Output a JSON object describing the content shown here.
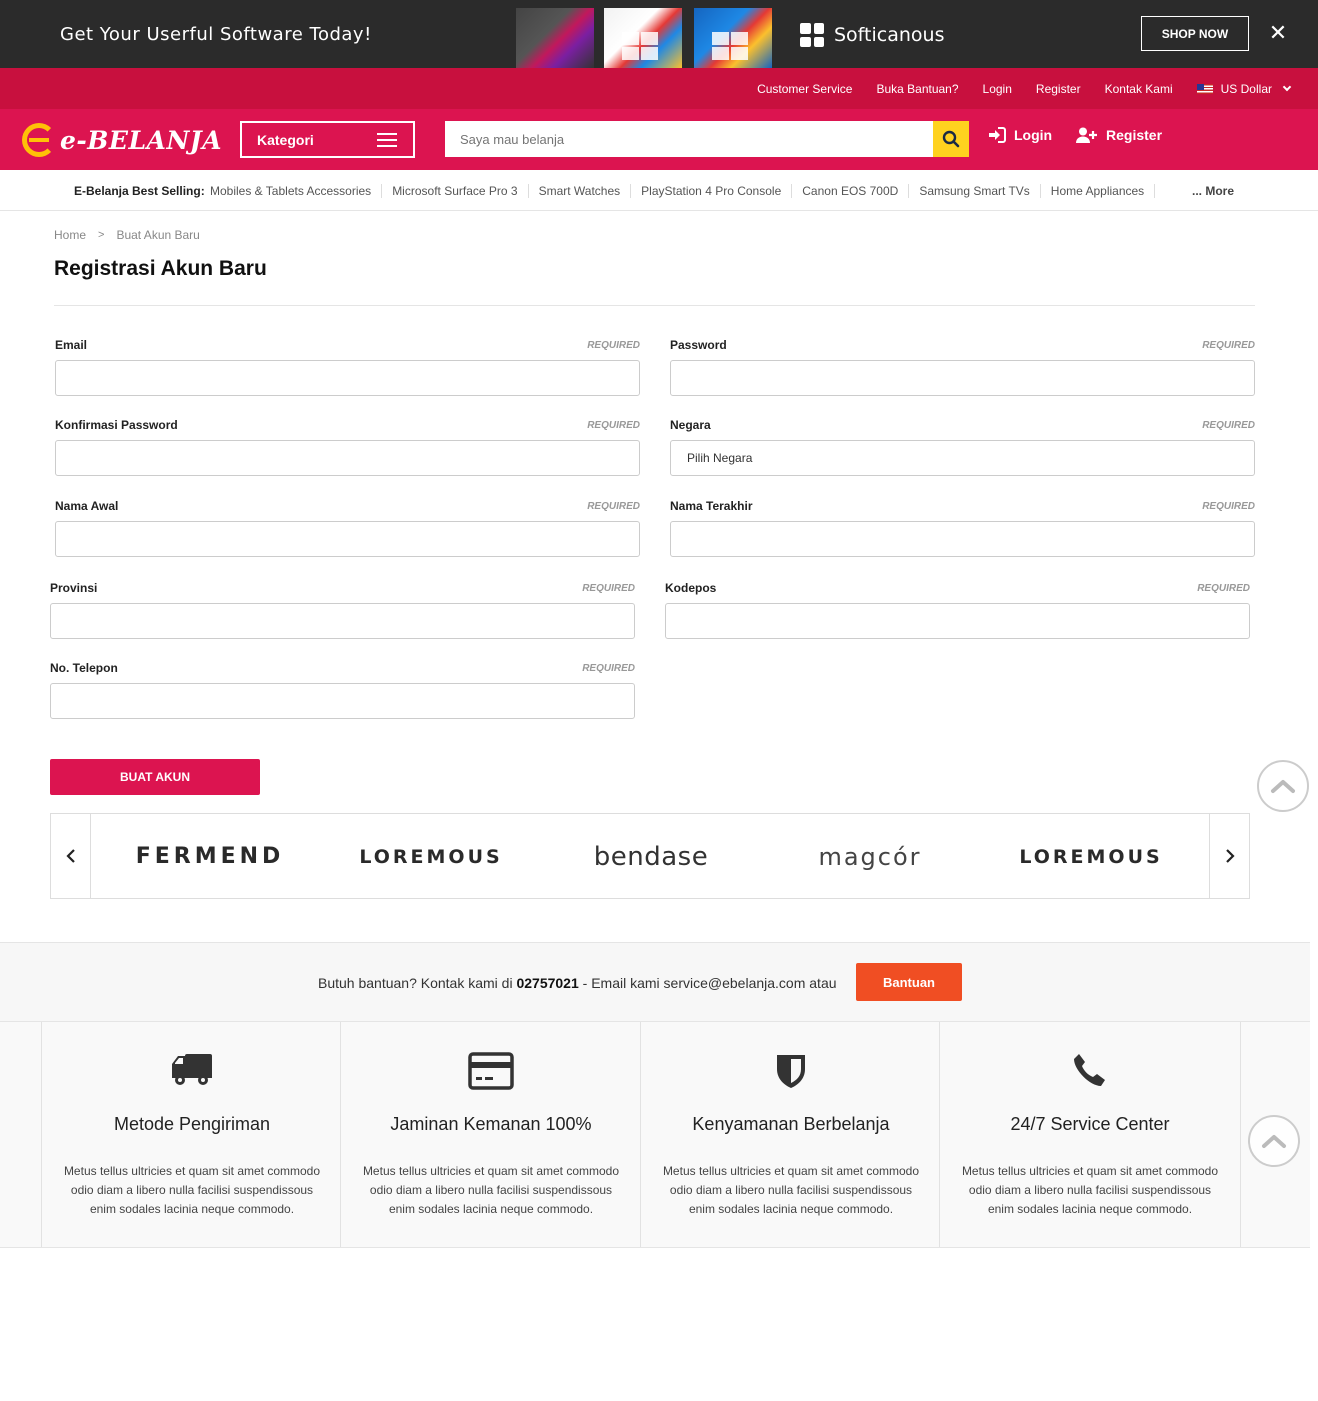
{
  "promo": {
    "title": "Get Your Userful Software Today!",
    "brand": "Softicanous",
    "cta": "SHOP NOW",
    "close": "✕"
  },
  "toplinks": [
    {
      "label": "Customer Service"
    },
    {
      "label": "Buka Bantuan?"
    },
    {
      "label": "Login"
    },
    {
      "label": "Register"
    },
    {
      "label": "Kontak Kami"
    }
  ],
  "currency": "US Dollar",
  "header": {
    "logo": "e-BELANJA",
    "kategori": "Kategori",
    "search_placeholder": "Saya mau belanja",
    "login": "Login",
    "register": "Register"
  },
  "bestselling": {
    "label": "E-Belanja Best Selling:",
    "items": [
      "Mobiles & Tablets Accessories",
      "Microsoft Surface Pro 3",
      "Smart Watches",
      "PlayStation 4 Pro Console",
      "Canon EOS 700D",
      "Samsung Smart TVs",
      "Home Appliances"
    ],
    "more": "... More"
  },
  "breadcrumb": {
    "home": "Home",
    "sep": ">",
    "current": "Buat Akun Baru"
  },
  "page_title": "Registrasi Akun Baru",
  "form": {
    "required": "REQUIRED",
    "email": {
      "label": "Email",
      "value": ""
    },
    "password": {
      "label": "Password",
      "value": ""
    },
    "confirm": {
      "label": "Konfirmasi Password",
      "value": ""
    },
    "negara": {
      "label": "Negara",
      "value": "Pilih Negara"
    },
    "first_name": {
      "label": "Nama Awal",
      "value": ""
    },
    "last_name": {
      "label": "Nama Terakhir",
      "value": ""
    },
    "provinsi": {
      "label": "Provinsi",
      "value": ""
    },
    "kodepos": {
      "label": "Kodepos",
      "value": ""
    },
    "telepon": {
      "label": "No. Telepon",
      "value": ""
    },
    "submit": "BUAT AKUN"
  },
  "brands": [
    "FERMEND",
    "LOREMOUS",
    "bendase",
    "magcór",
    "LOREMOUS"
  ],
  "help": {
    "prefix": "Butuh bantuan? Kontak kami di ",
    "phone": "02757021",
    "suffix": " - Email kami service@ebelanja.com atau",
    "button": "Bantuan"
  },
  "features": [
    {
      "icon": "truck-icon",
      "title": "Metode Pengiriman",
      "desc": "Metus tellus ultricies et quam sit amet commodo odio diam a libero nulla facilisi suspendissous enim sodales lacinia neque commodo."
    },
    {
      "icon": "credit-card-icon",
      "title": "Jaminan Kemanan 100%",
      "desc": "Metus tellus ultricies et quam sit amet commodo odio diam a libero nulla facilisi suspendissous enim sodales lacinia neque commodo."
    },
    {
      "icon": "shield-icon",
      "title": "Kenyamanan Berbelanja",
      "desc": "Metus tellus ultricies et quam sit amet commodo odio diam a libero nulla facilisi suspendissous enim sodales lacinia neque commodo."
    },
    {
      "icon": "phone-icon",
      "title": "24/7 Service Center",
      "desc": "Metus tellus ultricies et quam sit amet commodo odio diam a libero nulla facilisi suspendissous enim sodales lacinia neque commodo."
    }
  ],
  "colors": {
    "brand": "#dc1450",
    "topbar": "#c8103e",
    "search_button": "#ffd21f",
    "help_button": "#f04e23",
    "promo_bg": "#2b2b2b"
  }
}
